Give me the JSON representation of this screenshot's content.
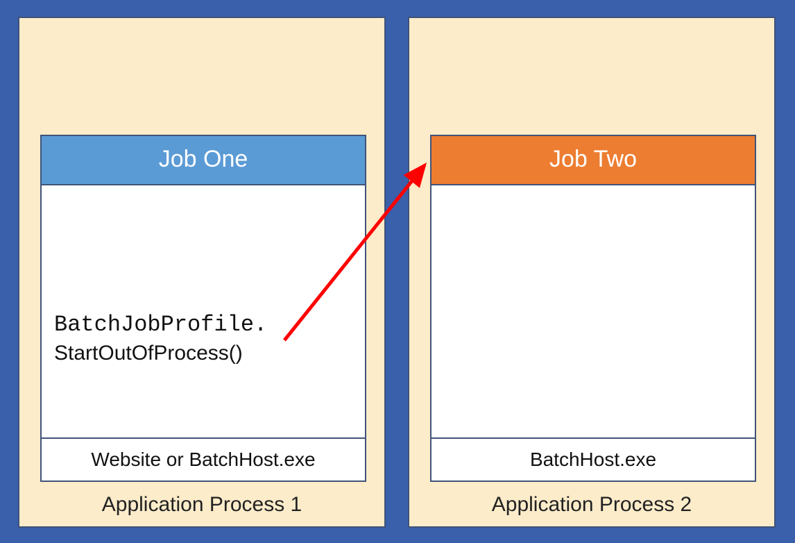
{
  "colors": {
    "background": "#3A5FAB",
    "panel": "#FCECCA",
    "border": "#3F5379",
    "job1_header": "#5B9BD5",
    "job2_header": "#ED7D31",
    "arrow": "#FF0000"
  },
  "process1": {
    "label": "Application Process 1",
    "job": {
      "title": "Job One",
      "code_line1": "BatchJobProfile.",
      "code_line2": "StartOutOfProcess()",
      "footer": "Website or BatchHost.exe"
    }
  },
  "process2": {
    "label": "Application Process 2",
    "job": {
      "title": "Job Two",
      "footer": "BatchHost.exe"
    }
  }
}
